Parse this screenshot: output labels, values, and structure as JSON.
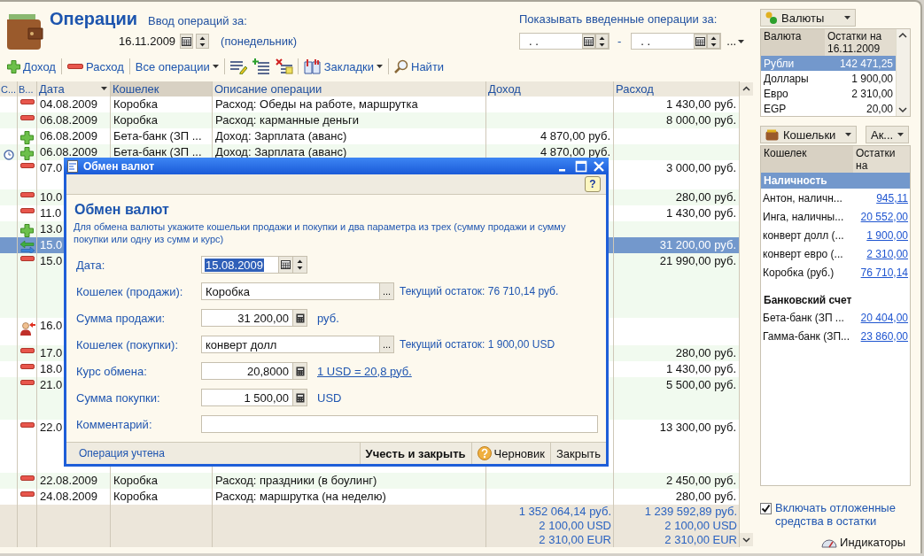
{
  "header": {
    "title": "Операции",
    "entry_label": "Ввод операций за:",
    "entry_date": "16.11.2009",
    "weekday": "(понедельник)",
    "show_label": "Показывать введенные операции за:",
    "from_date": ".  .",
    "dash": "-",
    "to_date": ".  .",
    "more": "..."
  },
  "toolbar": [
    {
      "kind": "income",
      "label": "Доход"
    },
    {
      "kind": "expense",
      "label": "Расход"
    },
    {
      "kind": "menu",
      "label": "Все операции"
    },
    {
      "kind": "edit"
    },
    {
      "kind": "add"
    },
    {
      "kind": "delete"
    },
    {
      "kind": "bookmarks",
      "label": "Закладки"
    },
    {
      "kind": "find",
      "label": "Найти"
    }
  ],
  "table": {
    "columns": [
      {
        "label": "С...",
        "sorted": false,
        "selected": false
      },
      {
        "label": "В...",
        "sorted": false,
        "selected": false
      },
      {
        "label": "Дата",
        "sorted": true,
        "selected": false
      },
      {
        "label": "Кошелек",
        "sorted": false,
        "selected": true
      },
      {
        "label": "Описание операции",
        "sorted": false,
        "selected": false
      },
      {
        "label": "Доход",
        "sorted": false,
        "selected": false
      },
      {
        "label": "Расход",
        "sorted": false,
        "selected": false
      }
    ],
    "rows": [
      {
        "kind": "expense",
        "date": "04.08.2009",
        "wallet": "Коробка",
        "description": "Расход: Обеды на работе, маршрутка",
        "expense": "1 430,00 руб.",
        "selected": false,
        "scheduled": false
      },
      {
        "kind": "expense",
        "date": "06.08.2009",
        "wallet": "Коробка",
        "description": "Расход: карманные деньги",
        "expense": "8 000,00 руб.",
        "selected": false,
        "scheduled": false
      },
      {
        "kind": "income",
        "date": "06.08.2009",
        "wallet": "Бета-банк (ЗП ...",
        "description": "Доход: Зарплата (аванс)",
        "income": "4 870,00 руб.",
        "selected": false,
        "scheduled": false
      },
      {
        "kind": "income",
        "date": "06.08.2009",
        "wallet": "Бета-банк (ЗП ...",
        "description": "Доход: Зарплата (аванс)",
        "income": "4 870,00 руб.",
        "selected": false,
        "scheduled": true
      },
      {
        "kind": "expense",
        "date": "07.0",
        "expense": "3 000,00 руб.",
        "selected": false,
        "scheduled": false
      },
      {
        "kind": "expense",
        "date": "10.0",
        "expense": "280,00 руб.",
        "selected": false,
        "scheduled": false
      },
      {
        "kind": "expense",
        "date": "11.0",
        "expense": "1 430,00 руб.",
        "selected": false,
        "scheduled": false
      },
      {
        "kind": "income",
        "date": "13.0",
        "selected": false,
        "scheduled": false
      },
      {
        "kind": "exchange",
        "date": "15.0",
        "expense": "31 200,00 руб.",
        "selected": true,
        "scheduled": false
      },
      {
        "kind": "expense",
        "date": "15.0",
        "expense": "21 990,00 руб.",
        "selected": false,
        "scheduled": false
      },
      {
        "kind": "transfer",
        "date": "16.0",
        "selected": false,
        "scheduled": false
      },
      {
        "kind": "expense",
        "date": "17.0",
        "expense": "280,00 руб.",
        "selected": false,
        "scheduled": false
      },
      {
        "kind": "expense",
        "date": "18.0",
        "expense": "1 430,00 руб.",
        "selected": false,
        "scheduled": false
      },
      {
        "kind": "expense",
        "date": "21.0",
        "expense": "5 500,00 руб.",
        "selected": false,
        "scheduled": false
      },
      {
        "kind": "expense",
        "date": "22.0",
        "expense": "13 300,00 руб.",
        "selected": false,
        "scheduled": false
      },
      {
        "kind": "expense",
        "date": "22.08.2009",
        "wallet": "Коробка",
        "description": "Расход: праздники (в боулинг)",
        "expense": "2 450,00 руб.",
        "selected": false,
        "scheduled": false
      },
      {
        "kind": "expense",
        "date": "24.08.2009",
        "wallet": "Коробка",
        "description": "Расход: маршрутка (на неделю)",
        "expense": "280,00 руб.",
        "selected": false,
        "scheduled": false
      }
    ],
    "totals": {
      "income": [
        "1 352 064,14 руб.",
        "2 100,00 USD",
        "2 310,00 EUR"
      ],
      "expense": [
        "1 239 592,89 руб.",
        "2 100,00 USD",
        "2 310,00 EUR"
      ]
    }
  },
  "dialog": {
    "title": "Обмен валют",
    "help": "?",
    "heading": "Обмен валют",
    "hint": "Для обмена валюты укажите кошельки продажи и покупки и два параметра из трех (сумму продажи и сумму покупки или одну из сумм и курс)",
    "fields": [
      {
        "kind": "date",
        "label": "Дата:",
        "value": "15.08.2009"
      },
      {
        "kind": "picker",
        "label": "Кошелек (продажи):",
        "value": "Коробка",
        "button": "...",
        "note": "Текущий остаток: 76 710,14 руб."
      },
      {
        "kind": "amount",
        "label": "Сумма продажи:",
        "value": "31 200,00",
        "note": "руб."
      },
      {
        "kind": "picker",
        "label": "Кошелек (покупки):",
        "value": "конверт долл",
        "button": "...",
        "note": "Текущий остаток: 1 900,00 USD"
      },
      {
        "kind": "amount",
        "label": "Курс обмена:",
        "value": "20,8000",
        "link": "1 USD = 20,8 руб."
      },
      {
        "kind": "amount",
        "label": "Сумма покупки:",
        "value": "1 500,00",
        "note": "USD"
      },
      {
        "kind": "text",
        "label": "Комментарий:"
      }
    ],
    "status": "Операция учтена",
    "buttons": [
      {
        "kind": "default",
        "label": "Учесть и закрыть"
      },
      {
        "kind": "help",
        "label": "Черновик"
      },
      {
        "kind": "plain",
        "label": "Закрыть"
      }
    ]
  },
  "side": {
    "currencies": {
      "button": "Валюты",
      "columns": [
        "Валюта",
        "Остатки на 16.11.2009"
      ],
      "rows": [
        {
          "name": "Рубли",
          "amount": "142 471,25",
          "selected": true
        },
        {
          "name": "Доллары",
          "amount": "1 900,00",
          "selected": false
        },
        {
          "name": "Евро",
          "amount": "2 310,00",
          "selected": false
        },
        {
          "name": "EGP",
          "amount": "20,00",
          "selected": false
        }
      ]
    },
    "wallets": {
      "button": "Кошельки",
      "filter": "Ак...",
      "columns": [
        "Кошелек",
        "Остатки на"
      ],
      "groups": [
        {
          "name": "Наличность",
          "selected": true,
          "children": [
            {
              "name": "Антон,  наличн...",
              "amount": "945,11"
            },
            {
              "name": "Инга, наличны...",
              "amount": "20 552,00"
            },
            {
              "name": "конверт долл (...",
              "amount": "1 900,00"
            },
            {
              "name": "конверт евро (...",
              "amount": "2 310,00"
            },
            {
              "name": "Коробка (руб.)",
              "amount": "76 710,14"
            }
          ]
        },
        {
          "name": "Банковский счет",
          "selected": false,
          "children": [
            {
              "name": "Бета-банк (ЗП ...",
              "amount": "20 404,00"
            },
            {
              "name": "Гамма-банк (ЗП...",
              "amount": "23 860,00"
            }
          ]
        }
      ]
    },
    "include_deferred": {
      "label": "Включать отложенные средства в остатки",
      "checked": true
    },
    "indicators": "Индикаторы"
  }
}
